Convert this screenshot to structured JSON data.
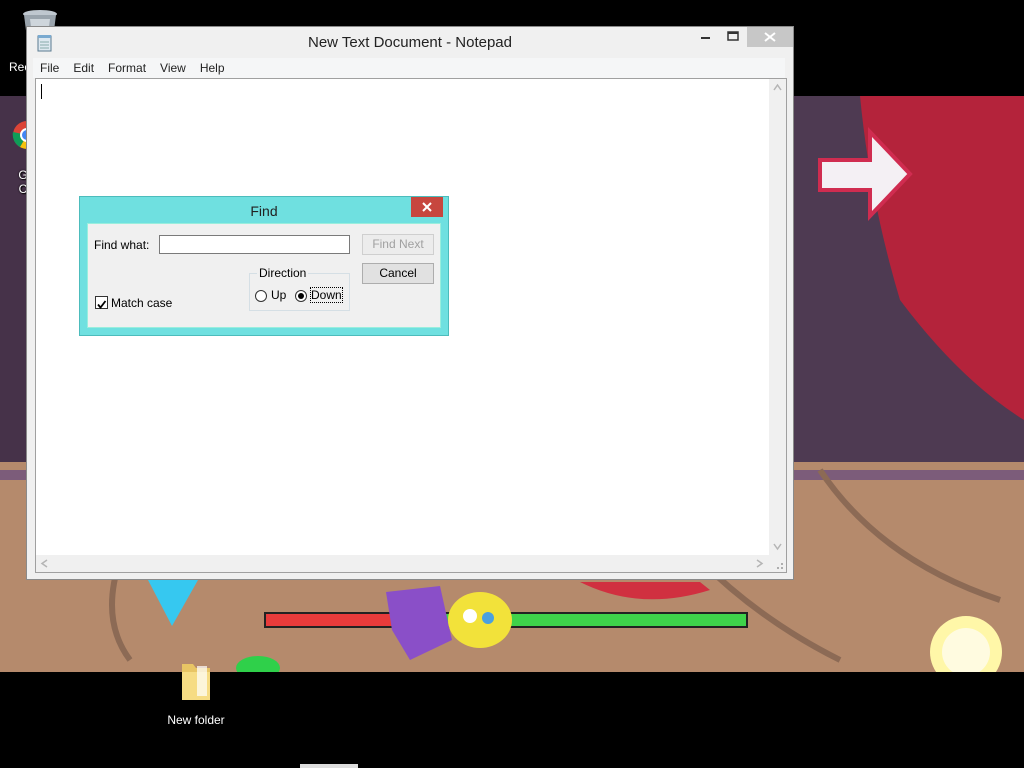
{
  "desktop": {
    "recycle_bin_label": "Rec",
    "chrome_label": "G C",
    "new_folder_label": "New folder"
  },
  "notepad": {
    "title": "New Text Document - Notepad",
    "menu": [
      "File",
      "Edit",
      "Format",
      "View",
      "Help"
    ],
    "content": ""
  },
  "find_dialog": {
    "title": "Find",
    "find_what_label": "Find what:",
    "find_what_value": "",
    "find_next_label": "Find Next",
    "cancel_label": "Cancel",
    "direction_label": "Direction",
    "up_label": "Up",
    "down_label": "Down",
    "direction_selected": "Down",
    "match_case_label": "Match case",
    "match_case_checked": true
  },
  "colors": {
    "find_frame": "#6fe0e0",
    "close_red": "#c7463e",
    "health_red": "#e83b3b",
    "health_green": "#3fd24a"
  }
}
